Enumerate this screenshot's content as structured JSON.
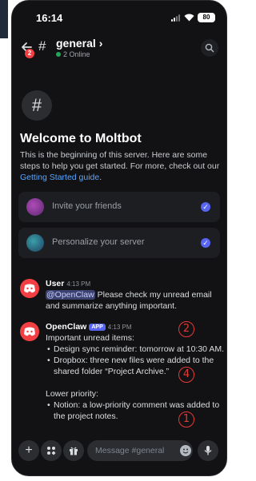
{
  "status_bar": {
    "time": "16:14",
    "battery": "80"
  },
  "header": {
    "back_badge": "2",
    "channel_name": "general",
    "channel_chevron": "›",
    "online_text": "2 Online"
  },
  "welcome": {
    "hash": "#",
    "title": "Welcome to Moltbot",
    "desc_prefix": "This is the beginning of this server. Here are some steps to help you get started. For more, check out our ",
    "desc_link": "Getting Started guide",
    "desc_suffix": "."
  },
  "cards": [
    {
      "label": "Invite your friends",
      "check": "✓"
    },
    {
      "label": "Personalize your server",
      "check": "✓"
    }
  ],
  "messages": [
    {
      "author": "User",
      "time": "4:13 PM",
      "mention": "@OpenClaw",
      "text": " Please check my unread email and summarize anything important."
    },
    {
      "author": "OpenClaw",
      "tag": "APP",
      "time": "4:13 PM",
      "heading": "Important unread items:",
      "items": [
        "Design sync reminder: tomorrow at 10:30 AM.",
        "Dropbox: three new files were added to the shared folder “Project Archive.”"
      ],
      "heading2": "Lower priority:",
      "items2": [
        "Notion: a low-priority comment was added to the project notes."
      ]
    }
  ],
  "annotations": [
    "2",
    "4",
    "1"
  ],
  "composer": {
    "placeholder": "Message #general"
  }
}
